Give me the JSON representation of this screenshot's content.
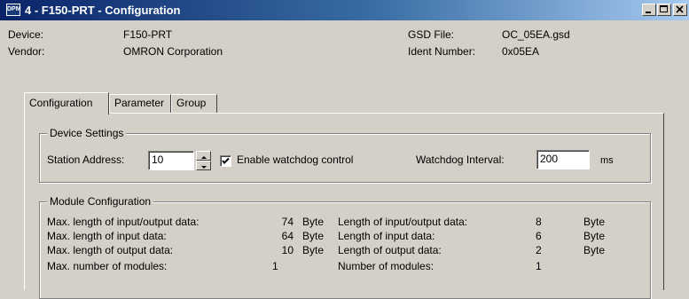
{
  "window": {
    "title": "4 - F150-PRT - Configuration",
    "icon_text": "DPM",
    "controls": [
      "minimize-icon",
      "maximize-icon",
      "close-icon"
    ]
  },
  "device_info": {
    "device_label": "Device:",
    "device_value": "F150-PRT",
    "vendor_label": "Vendor:",
    "vendor_value": "OMRON Corporation",
    "gsd_label": "GSD File:",
    "gsd_value": "OC_05EA.gsd",
    "ident_label": "Ident Number:",
    "ident_value": "0x05EA"
  },
  "tabs": [
    {
      "label": "Configuration",
      "active": true
    },
    {
      "label": "Parameter",
      "active": false
    },
    {
      "label": "Group",
      "active": false
    }
  ],
  "device_settings": {
    "title": "Device Settings",
    "station_address_label": "Station Address:",
    "station_address_value": "10",
    "watchdog_checkbox_label": "Enable watchdog control",
    "watchdog_checked": true,
    "watchdog_interval_label": "Watchdog Interval:",
    "watchdog_interval_value": "200",
    "watchdog_unit": "ms"
  },
  "module_config": {
    "title": "Module Configuration",
    "rows": [
      {
        "left_label": "Max. length of input/output data:",
        "left_value": "74",
        "left_unit": "Byte",
        "right_label": "Length of input/output data:",
        "right_value": "8",
        "right_unit": "Byte"
      },
      {
        "left_label": "Max. length of input data:",
        "left_value": "64",
        "left_unit": "Byte",
        "right_label": "Length of input data:",
        "right_value": "6",
        "right_unit": "Byte"
      },
      {
        "left_label": "Max. length of output data:",
        "left_value": "10",
        "left_unit": "Byte",
        "right_label": "Length of output data:",
        "right_value": "2",
        "right_unit": "Byte"
      },
      {
        "left_label": "Max. number of modules:",
        "left_value": "1",
        "left_unit": "",
        "right_label": "Number of modules:",
        "right_value": "1",
        "right_unit": ""
      }
    ]
  }
}
